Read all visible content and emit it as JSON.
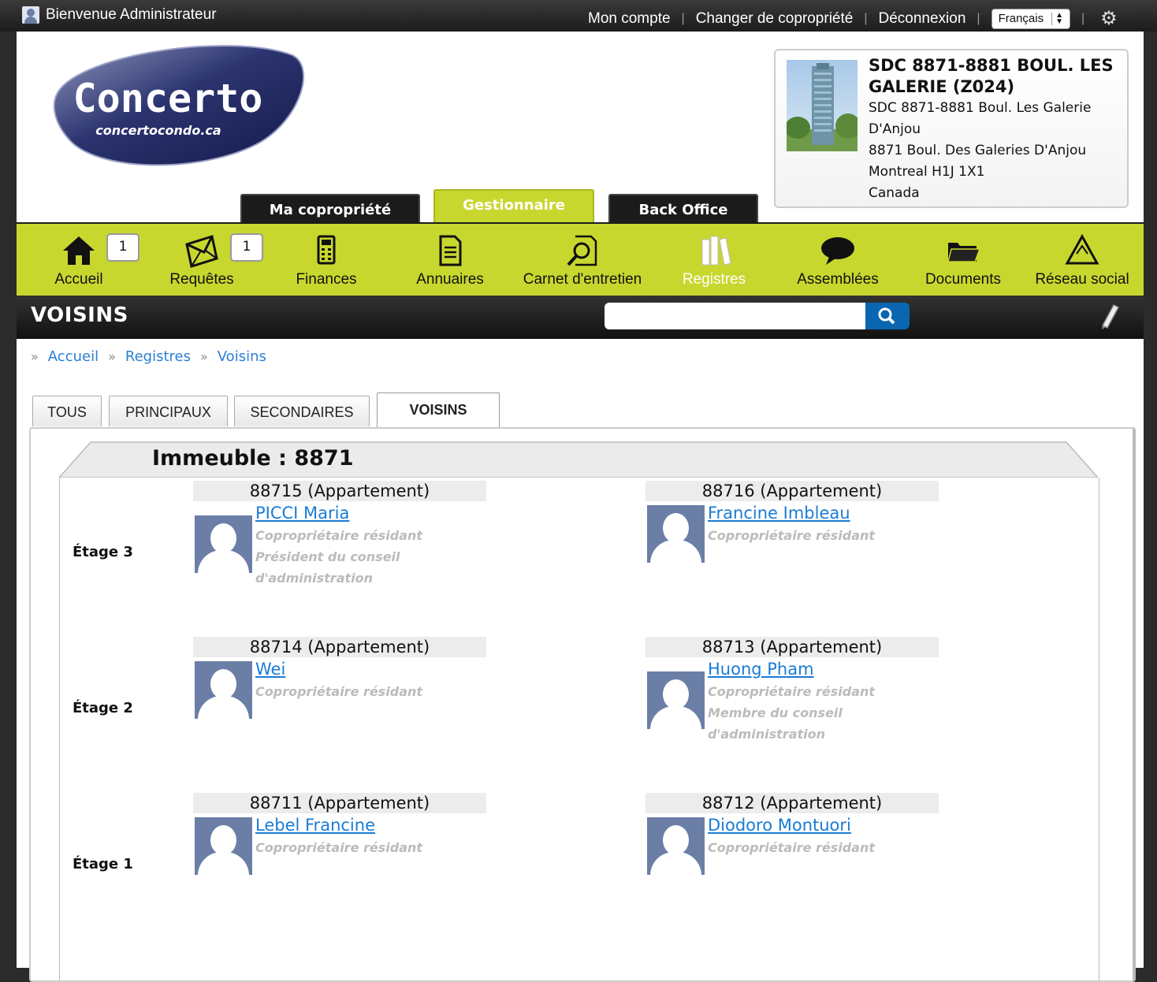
{
  "topbar": {
    "welcome": "Bienvenue Administrateur",
    "links": [
      "Mon compte",
      "Changer de copropriété",
      "Déconnexion"
    ],
    "language": "Français"
  },
  "logo": {
    "name": "Concerto",
    "url": "concertocondo.ca"
  },
  "property": {
    "title": "SDC 8871-8881 BOUL. LES GALERIE (Z024)",
    "line1": "SDC 8871-8881 Boul. Les Galerie D'Anjou",
    "line2": "8871 Boul. Des Galeries D'Anjou",
    "line3": "Montreal H1J 1X1",
    "line4": "Canada"
  },
  "main_tabs": [
    "Ma copropriété",
    "Gestionnaire",
    "Back Office"
  ],
  "nav": {
    "items": [
      "Accueil",
      "Requêtes",
      "Finances",
      "Annuaires",
      "Carnet d'entretien",
      "Registres",
      "Assemblées",
      "Documents",
      "Réseau social"
    ],
    "badges": {
      "accueil": "1",
      "requetes": "1"
    },
    "active": "Registres"
  },
  "section": {
    "title": "VOISINS",
    "search_value": ""
  },
  "breadcrumb": [
    "Accueil",
    "Registres",
    "Voisins"
  ],
  "sub_tabs": [
    "TOUS",
    "PRINCIPAUX",
    "SECONDAIRES",
    "VOISINS"
  ],
  "building": {
    "title": "Immeuble : 8871"
  },
  "floors": [
    {
      "label": "Étage 3",
      "units": [
        {
          "unit": "88715 (Appartement)",
          "name": "PICCI Maria",
          "roles": [
            "Copropriétaire résidant",
            "Président du conseil",
            "d'administration"
          ]
        },
        {
          "unit": "88716 (Appartement)",
          "name": "Francine Imbleau",
          "roles": [
            "Copropriétaire résidant"
          ]
        }
      ]
    },
    {
      "label": "Étage 2",
      "units": [
        {
          "unit": "88714 (Appartement)",
          "name": "Wei",
          "roles": [
            "Copropriétaire résidant"
          ]
        },
        {
          "unit": "88713 (Appartement)",
          "name": "Huong Pham",
          "roles": [
            "Copropriétaire résidant",
            "Membre du conseil",
            "d'administration"
          ]
        }
      ]
    },
    {
      "label": "Étage 1",
      "units": [
        {
          "unit": "88711 (Appartement)",
          "name": "Lebel Francine",
          "roles": [
            "Copropriétaire résidant"
          ]
        },
        {
          "unit": "88712 (Appartement)",
          "name": "Diodoro Montuori",
          "roles": [
            "Copropriétaire résidant"
          ]
        }
      ]
    }
  ],
  "colors": {
    "nav_green": "#c8d72e",
    "link_blue": "#1a7bd6",
    "search_blue": "#0a66b0"
  }
}
